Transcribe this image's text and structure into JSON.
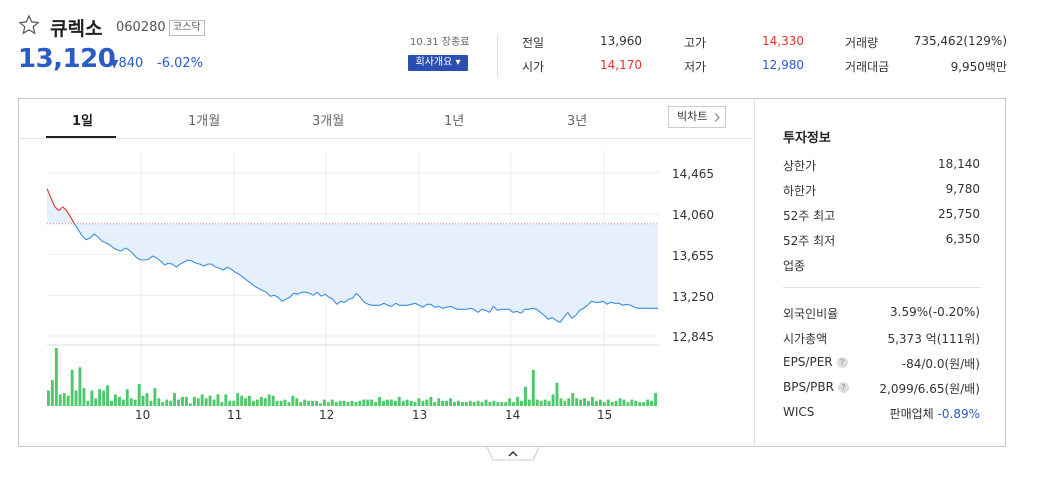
{
  "header": {
    "name": "큐렉소",
    "code": "060280",
    "market": "코스닥",
    "price": "13,120",
    "change_arrow": "▼",
    "change": "840",
    "change_pct": "-6.02%",
    "datetime": "10.31 장종료",
    "overview_btn": "회사개요 ▾"
  },
  "stats": [
    {
      "label": "전일",
      "value": "13,960",
      "color": "normal"
    },
    {
      "label": "고가",
      "value": "14,330",
      "color": "red"
    },
    {
      "label": "거래량",
      "value": "735,462(129%)",
      "color": "normal"
    },
    {
      "label": "시가",
      "value": "14,170",
      "color": "red"
    },
    {
      "label": "저가",
      "value": "12,980",
      "color": "blue"
    },
    {
      "label": "거래대금",
      "value": "9,950백만",
      "color": "normal"
    }
  ],
  "tabs": [
    "1일",
    "1개월",
    "3개월",
    "1년",
    "3년"
  ],
  "big_chart_btn": "빅차트",
  "chart_data": {
    "type": "line",
    "y_ticks": [
      "14,465",
      "14,060",
      "13,655",
      "13,250",
      "12,845"
    ],
    "x_ticks": [
      "10",
      "11",
      "12",
      "13",
      "14",
      "15"
    ],
    "prev_close": 13960,
    "ylim": [
      12845,
      14465
    ],
    "series": [
      {
        "values": [
          14310,
          14220,
          14130,
          14090,
          14130,
          14090,
          14030,
          13960,
          13900,
          13840,
          13800,
          13820,
          13860,
          13830,
          13790,
          13770,
          13750,
          13720,
          13700,
          13690,
          13720,
          13700,
          13660,
          13620,
          13600,
          13600,
          13610,
          13640,
          13620,
          13590,
          13550,
          13570,
          13560,
          13530,
          13560,
          13580,
          13600,
          13590,
          13570,
          13560,
          13540,
          13560,
          13560,
          13530,
          13520,
          13500,
          13530,
          13510,
          13480,
          13460,
          13430,
          13400,
          13370,
          13340,
          13320,
          13300,
          13280,
          13240,
          13250,
          13230,
          13190,
          13210,
          13230,
          13270,
          13260,
          13280,
          13280,
          13270,
          13250,
          13280,
          13240,
          13260,
          13230,
          13210,
          13160,
          13190,
          13180,
          13210,
          13220,
          13270,
          13230,
          13180,
          13160,
          13150,
          13150,
          13150,
          13170,
          13150,
          13140,
          13170,
          13150,
          13150,
          13150,
          13160,
          13170,
          13150,
          13130,
          13160,
          13160,
          13130,
          13140,
          13120,
          13130,
          13140,
          13120,
          13110,
          13110,
          13110,
          13120,
          13110,
          13080,
          13110,
          13100,
          13080,
          13140,
          13100,
          13110,
          13110,
          13110,
          13080,
          13090,
          13070,
          13110,
          13110,
          13120,
          13110,
          13080,
          13050,
          13010,
          13030,
          13000,
          12980,
          13030,
          13080,
          13020,
          13050,
          13100,
          13120,
          13150,
          13190,
          13180,
          13180,
          13190,
          13160,
          13180,
          13170,
          13170,
          13150,
          13160,
          13150,
          13130,
          13120,
          13120,
          13120,
          13120,
          13120,
          13120
        ]
      }
    ],
    "volume": [
      12,
      20,
      45,
      9,
      10,
      8,
      28,
      12,
      30,
      14,
      4,
      12,
      6,
      13,
      12,
      16,
      4,
      9,
      7,
      5,
      13,
      6,
      5,
      17,
      8,
      10,
      4,
      14,
      6,
      3,
      5,
      4,
      10,
      5,
      7,
      7,
      2,
      7,
      6,
      9,
      6,
      8,
      5,
      9,
      3,
      9,
      4,
      4,
      10,
      8,
      6,
      8,
      4,
      5,
      7,
      6,
      9,
      8,
      4,
      4,
      5,
      3,
      8,
      6,
      3,
      5,
      4,
      4,
      4,
      2,
      5,
      3,
      5,
      3,
      4,
      4,
      3,
      4,
      3,
      4,
      5,
      5,
      5,
      3,
      7,
      4,
      5,
      5,
      4,
      7,
      4,
      5,
      4,
      3,
      6,
      4,
      5,
      7,
      3,
      6,
      4,
      4,
      6,
      3,
      4,
      3,
      3,
      4,
      3,
      4,
      3,
      5,
      3,
      4,
      3,
      3,
      3,
      6,
      3,
      7,
      4,
      15,
      5,
      28,
      5,
      4,
      5,
      4,
      9,
      18,
      6,
      4,
      6,
      10,
      6,
      5,
      6,
      4,
      7,
      4,
      5,
      3,
      5,
      3,
      4,
      6,
      5,
      3,
      5,
      4,
      3,
      3,
      5,
      4,
      10
    ],
    "colors": {
      "up": "#e0352b",
      "down": "#3b8de0",
      "fill": "#e6f0fd",
      "volume": "#4fc86b"
    }
  },
  "invest": {
    "title": "투자정보",
    "rows": [
      {
        "label": "상한가",
        "value": "18,140",
        "color": "red"
      },
      {
        "label": "하한가",
        "value": "9,780",
        "color": "blue"
      },
      {
        "label": "52주 최고",
        "value": "25,750",
        "color": "normal"
      },
      {
        "label": "52주 최저",
        "value": "6,350",
        "color": "normal"
      },
      {
        "label": "업종",
        "value": "",
        "color": "normal"
      }
    ],
    "rows2": [
      {
        "label": "외국인비율",
        "value": "3.59%",
        "sub": "(-0.20%)"
      },
      {
        "label": "시가총액",
        "value": "5,373 억",
        "sub": "(111위)"
      },
      {
        "label": "EPS/PER",
        "value": "-84/0.0",
        "sub": "(원/배)",
        "help": "?"
      },
      {
        "label": "BPS/PBR",
        "value": "2,099/6.65",
        "sub": "(원/배)",
        "help": "?"
      },
      {
        "label": "WICS",
        "value": "판매업체",
        "sub": "-0.89%"
      }
    ]
  }
}
